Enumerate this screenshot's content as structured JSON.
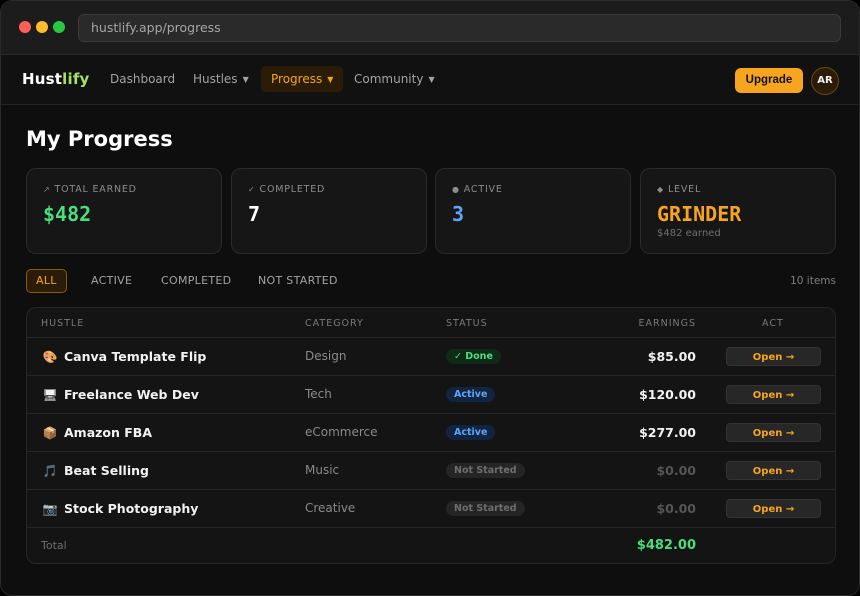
{
  "browser": {
    "url": "hustlify.app/progress"
  },
  "nav": {
    "logo_a": "Hust",
    "logo_b": "lify",
    "links": [
      "Dashboard",
      "Hustles",
      "Progress",
      "Community"
    ],
    "active": "Progress",
    "upgrade_label": "Upgrade",
    "avatar_initials": "AR"
  },
  "page": {
    "title": "My Progress"
  },
  "stats": [
    {
      "icon": "↗",
      "label": "TOTAL EARNED",
      "value": "$482",
      "color": "#4ade80",
      "sub": ""
    },
    {
      "icon": "✓",
      "label": "COMPLETED",
      "value": "7",
      "color": "#ffffff",
      "sub": ""
    },
    {
      "icon": "●",
      "label": "ACTIVE",
      "value": "3",
      "color": "#60a5fa",
      "sub": ""
    },
    {
      "icon": "◆",
      "label": "LEVEL",
      "value": "GRINDER",
      "color": "#f7a51e",
      "sub": "$482 earned"
    }
  ],
  "filters": [
    "ALL",
    "ACTIVE",
    "COMPLETED",
    "NOT STARTED"
  ],
  "active_filter": "ALL",
  "item_count": "10 items",
  "table": {
    "headers": [
      "HUSTLE",
      "CATEGORY",
      "STATUS",
      "EARNINGS",
      "ACT"
    ],
    "rows": [
      {
        "icon": "palette-icon",
        "emoji": "🎨",
        "name": "Canva Template Flip",
        "category": "Design",
        "status": "✓ Done",
        "status_type": "done",
        "earnings": "$85.00",
        "action": "Open →"
      },
      {
        "icon": "computer-icon",
        "emoji": "🖥",
        "name": "Freelance Web Dev",
        "category": "Tech",
        "status": "Active",
        "status_type": "active",
        "earnings": "$120.00",
        "action": "Open →"
      },
      {
        "icon": "package-icon",
        "emoji": "📦",
        "name": "Amazon FBA",
        "category": "eCommerce",
        "status": "Active",
        "status_type": "active",
        "earnings": "$277.00",
        "action": "Open →"
      },
      {
        "icon": "music-icon",
        "emoji": "🎵",
        "name": "Beat Selling",
        "category": "Music",
        "status": "Not Started",
        "status_type": "ns",
        "earnings": "$0.00",
        "action": "Open →"
      },
      {
        "icon": "camera-icon",
        "emoji": "📷",
        "name": "Stock Photography",
        "category": "Creative",
        "status": "Not Started",
        "status_type": "ns",
        "earnings": "$0.00",
        "action": "Open →"
      }
    ],
    "footer_label": "Total",
    "footer_total": "$482.00"
  },
  "colors": {
    "accent": "#f7a51e",
    "green": "#4ade80",
    "blue": "#60a5fa"
  }
}
